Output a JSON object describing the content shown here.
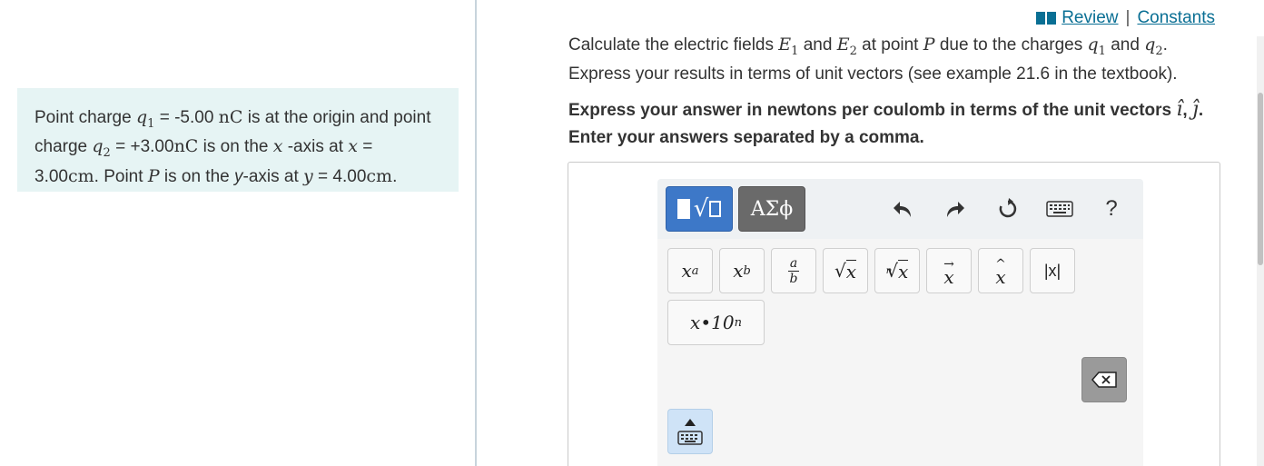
{
  "problem": {
    "text_1": "Point charge ",
    "q1": "q",
    "q1_sub": "1",
    "text_2": " = -5.00 ",
    "unit_1": "nC",
    "text_3": " is at the origin and point charge ",
    "q2": "q",
    "q2_sub": "2",
    "text_4": " = +3.00",
    "unit_2": "nC",
    "text_5": " is on the ",
    "x_var": "x",
    "text_6": " -axis at ",
    "x_var2": "x",
    "text_7": " = 3.00",
    "unit_3": "cm",
    "text_8": ". Point ",
    "p_var": "P",
    "text_9": " is on the ",
    "y_word": "y",
    "text_10": "-axis at ",
    "y_var": "y",
    "text_11": " = 4.00",
    "unit_4": "cm",
    "text_12": "."
  },
  "links": {
    "review": "Review",
    "separator": "|",
    "constants": "Constants"
  },
  "question": {
    "t1": "Calculate the electric fields ",
    "e": "E",
    "e1_sub": "1",
    "t2": " and ",
    "e2_sub": "2",
    "t3": " at point ",
    "p": "P",
    "t4": " due to the charges ",
    "q": "q",
    "q1_sub": "1",
    "t5": " and ",
    "q2_sub": "2",
    "t6": ".",
    "t7": "Express your results in terms of unit vectors (see example 21.6 in the textbook)."
  },
  "instruction": {
    "t1": "Express your answer in newtons per coulomb in terms of the unit vectors ",
    "i_hat": "î",
    "t2": ", ",
    "j_hat": "ĵ",
    "t3": ". Enter your answers separated by a comma."
  },
  "toolbar": {
    "greek_label": "ΑΣϕ",
    "help_label": "?"
  },
  "palette": {
    "superscript_base": "x",
    "superscript_exp": "a",
    "subscript_base": "x",
    "subscript_sub": "b",
    "fraction_num": "a",
    "fraction_den": "b",
    "sqrt_arg": "x",
    "nroot_index": "n",
    "nroot_arg": "x",
    "vector_arg": "x",
    "hat_arg": "x",
    "abs_label": "|x|",
    "sci_label": "x•10",
    "sci_exp": "n"
  }
}
